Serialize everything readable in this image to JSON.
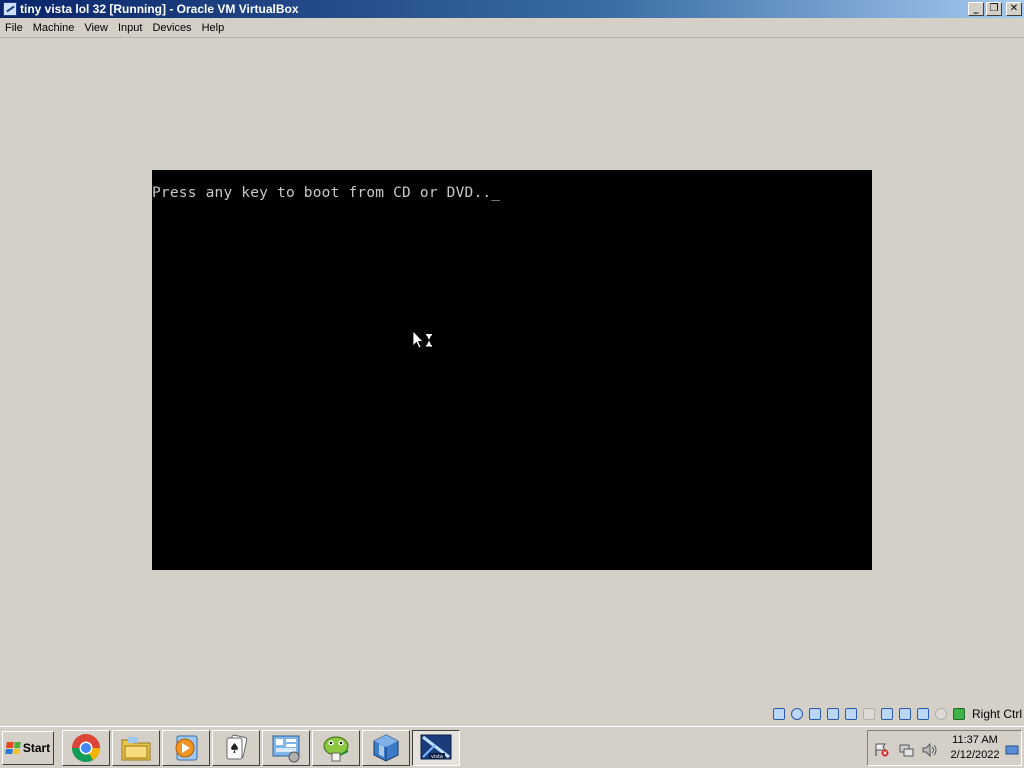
{
  "window": {
    "title": "tiny vista lol 32 [Running] - Oracle VM VirtualBox",
    "buttons": {
      "minimize": "_",
      "restore": "❐",
      "close": "✕"
    }
  },
  "menu": [
    "File",
    "Machine",
    "View",
    "Input",
    "Devices",
    "Help"
  ],
  "vm": {
    "console_text": "Press any key to boot from CD or DVD.._",
    "screen_color": "#000000",
    "text_color": "#c8c8c8"
  },
  "statusbar": {
    "icons": [
      "hard-disk-icon",
      "optical-drive-icon",
      "audio-icon",
      "network-icon",
      "usb-icon",
      "shared-folders-icon",
      "display-icon",
      "video-capture-icon",
      "virtualization-icon",
      "cpu-icon",
      "mouse-integration-icon",
      "keyboard-icon"
    ],
    "host_key": "Right Ctrl"
  },
  "taskbar": {
    "start_label": "Start",
    "apps": [
      "chrome-icon",
      "file-explorer-icon",
      "media-player-icon",
      "solitaire-icon",
      "control-panel-icon",
      "notepad-plus-plus-icon",
      "virtualbox-icon",
      "vista-vm-icon"
    ],
    "active_app": "vista-vm-icon",
    "clock": {
      "time": "11:37 AM",
      "date": "2/12/2022"
    }
  },
  "colors": {
    "titlebar_start": "#0a246a",
    "titlebar_end": "#a6caf0",
    "chrome": "#d4d0c8"
  }
}
